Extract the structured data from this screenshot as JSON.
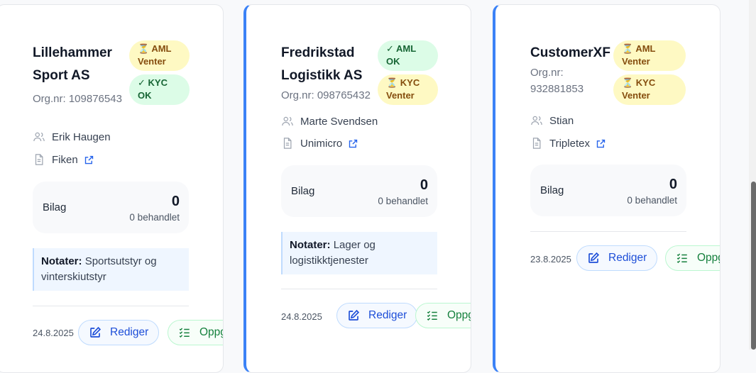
{
  "cards": [
    {
      "name": "Lillehammer Sport AS",
      "badges": [
        {
          "icon": "hourglass-icon",
          "text": "⏳ AML Venter",
          "status": "warn"
        },
        {
          "icon": "check-icon",
          "text": "✓ KYC OK",
          "status": "ok"
        }
      ],
      "orgnr": "Org.nr: 109876543",
      "contact": "Erik Haugen",
      "system": "Fiken",
      "stats": {
        "label": "Bilag",
        "count": "0",
        "processed": "0 behandlet"
      },
      "notes_label": "Notater:",
      "notes": "Sportsutstyr og vinterskiutstyr",
      "date": "24.8.2025",
      "edit_label": "Rediger",
      "tasks_label": "Oppgaver"
    },
    {
      "name": "Fredrikstad Logistikk AS",
      "badges": [
        {
          "icon": "check-icon",
          "text": "✓ AML OK",
          "status": "ok"
        },
        {
          "icon": "hourglass-icon",
          "text": "⏳ KYC Venter",
          "status": "warn"
        }
      ],
      "orgnr": "Org.nr: 098765432",
      "contact": "Marte Svendsen",
      "system": "Unimicro",
      "stats": {
        "label": "Bilag",
        "count": "0",
        "processed": "0 behandlet"
      },
      "notes_label": "Notater:",
      "notes": "Lager og logistikktjenester",
      "date": "24.8.2025",
      "edit_label": "Rediger",
      "tasks_label": "Oppgaver"
    },
    {
      "name": "CustomerXF",
      "badges": [
        {
          "icon": "hourglass-icon",
          "text": "⏳ AML Venter",
          "status": "warn"
        },
        {
          "icon": "hourglass-icon",
          "text": "⏳ KYC Venter",
          "status": "warn"
        }
      ],
      "orgnr": "Org.nr: 932881853",
      "contact": "Stian",
      "system": "Tripletex",
      "stats": {
        "label": "Bilag",
        "count": "0",
        "processed": "0 behandlet"
      },
      "date": "23.8.2025",
      "edit_label": "Rediger",
      "tasks_label": "Oppgaver"
    }
  ],
  "colors": {
    "accent": "#3b82f6",
    "warn_bg": "#fef9c3",
    "ok_bg": "#dcfce7",
    "edit": "#1d4ed8",
    "tasks": "#15803d"
  }
}
